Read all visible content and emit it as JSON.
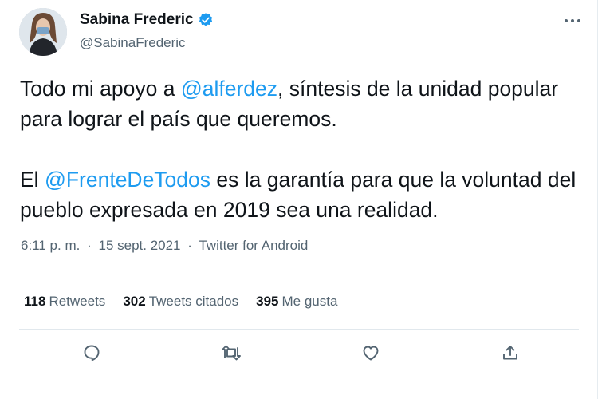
{
  "author": {
    "name": "Sabina Frederic",
    "handle": "@SabinaFrederic",
    "verified": true
  },
  "tweet": {
    "line1_pre": "Todo mi apoyo a ",
    "mention1": "@alferdez",
    "line1_post": ", síntesis de la unidad popular para lograr el país que queremos.",
    "line2_pre": "El ",
    "mention2": "@FrenteDeTodos",
    "line2_post": " es la garantía para que la voluntad del pueblo expresada en 2019 sea una realidad."
  },
  "meta": {
    "time": "6:11 p. m.",
    "separator": "·",
    "date": "15 sept. 2021",
    "source": "Twitter for Android"
  },
  "stats": {
    "retweets_count": "118",
    "retweets_label": "Retweets",
    "quotes_count": "302",
    "quotes_label": "Tweets citados",
    "likes_count": "395",
    "likes_label": "Me gusta"
  },
  "icons": {
    "reply": "reply-icon",
    "retweet": "retweet-icon",
    "like": "heart-icon",
    "share": "share-icon",
    "more": "more-icon",
    "verified": "verified-badge-icon"
  },
  "colors": {
    "accent": "#1d9bf0",
    "text": "#0f1419",
    "secondary": "#536471"
  }
}
